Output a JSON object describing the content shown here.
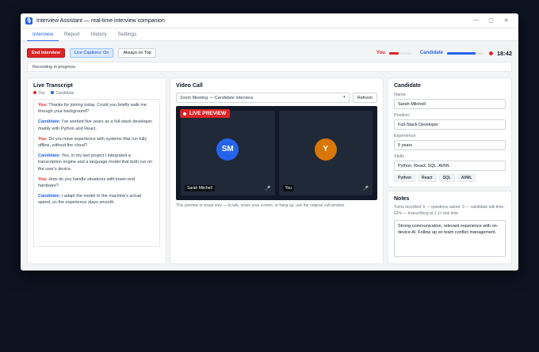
{
  "window": {
    "title": "Interview Assistant — real-time interview companion",
    "app_icon_glyph": "🎙",
    "controls": {
      "minimize": "—",
      "maximize": "▢",
      "close": "✕"
    }
  },
  "tabs": [
    "Interview",
    "Report",
    "History",
    "Settings"
  ],
  "active_tab": "Interview",
  "toolbar": {
    "end_interview": "End Interview",
    "live_captions": "Live Captions: On",
    "always_on_top": "Always on Top",
    "you_label": "You",
    "candidate_label": "Candidate",
    "you_level": 0.45,
    "candidate_level": 0.78,
    "timer": "18:42"
  },
  "status": "Recording in progress.",
  "transcript": {
    "title": "Live Transcript",
    "legend_you": "You",
    "legend_candidate": "Candidate",
    "messages": [
      {
        "speaker": "You:",
        "role": "you",
        "text": "Thanks for joining today. Could you briefly walk me through your background?"
      },
      {
        "speaker": "Candidate:",
        "role": "cand",
        "text": "I've worked five years as a full-stack developer, mainly with Python and React."
      },
      {
        "speaker": "You:",
        "role": "you",
        "text": "Do you have experience with systems that run fully offline, without the cloud?"
      },
      {
        "speaker": "Candidate:",
        "role": "cand",
        "text": "Yes, in my last project I integrated a transcription engine and a language model that both run on the user's device."
      },
      {
        "speaker": "You:",
        "role": "you",
        "text": "How do you handle situations with lower-end hardware?"
      },
      {
        "speaker": "Candidate:",
        "role": "cand",
        "text": "I adapt the model to the machine's actual speed, so the experience stays smooth."
      }
    ]
  },
  "video": {
    "title": "Video Call",
    "source": "Zoom Meeting — Candidate Interview",
    "refresh": "Refresh",
    "live_badge": "LIVE PREVIEW",
    "tiles": [
      {
        "initials": "SM",
        "name": "Sarah Mitchell",
        "color": "#2563eb"
      },
      {
        "initials": "Y",
        "name": "You",
        "color": "#d97706"
      }
    ],
    "note": "This preview is visual only — to talk, share your screen, or hang up, use the original call window."
  },
  "candidate": {
    "title": "Candidate",
    "name_label": "Name",
    "name": "Sarah Mitchell",
    "position_label": "Position",
    "position": "Full-Stack Developer",
    "experience_label": "Experience",
    "experience": "5 years",
    "skills_label": "Skills",
    "skills": "Python, React, SQL, AI/ML",
    "chips": [
      "Python",
      "React",
      "SQL",
      "AI/ML"
    ]
  },
  "notes": {
    "title": "Notes",
    "stats": "Turns recorded: 6 — questions asked: 3 — candidate talk time: 62% — transcribing at 1.1× real time",
    "text": "Strong communication, relevant experience with on-device AI. Follow up on team conflict management."
  },
  "colors": {
    "accent": "#2563eb",
    "danger": "#dc2626",
    "you": "#dc2626",
    "candidate": "#2563eb"
  }
}
